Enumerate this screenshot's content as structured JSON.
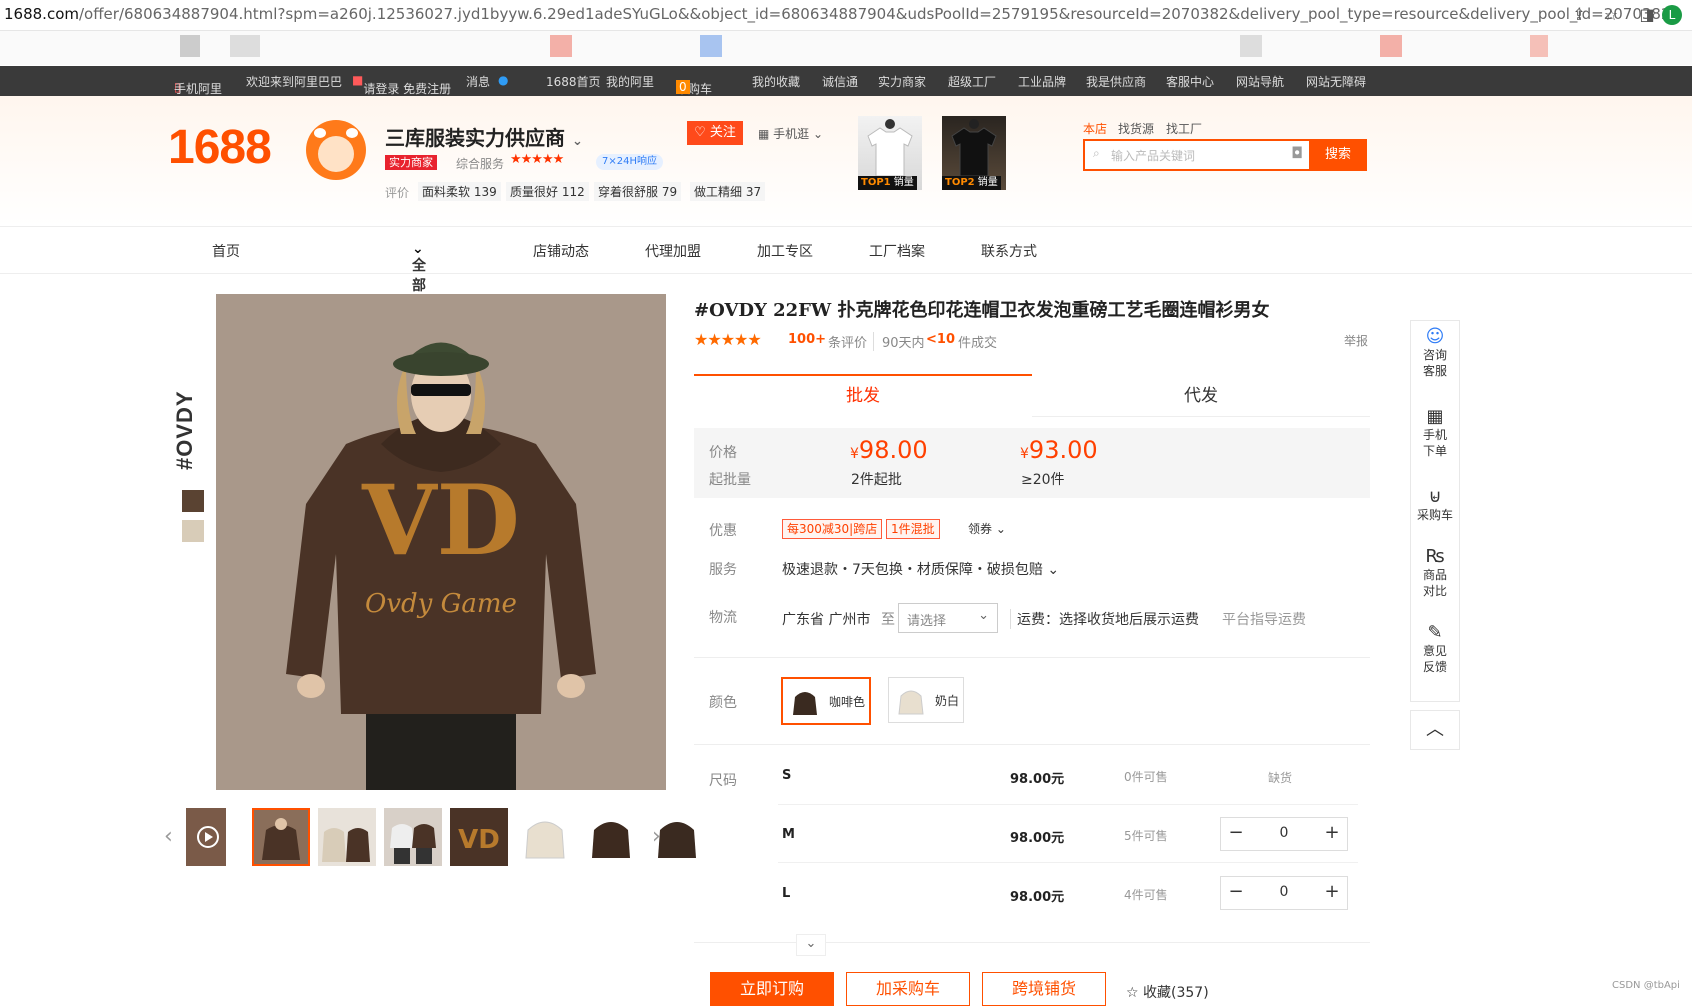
{
  "browser": {
    "url_domain": "1688.com",
    "url_rest": "/offer/680634887904.html?spm=a260j.12536027.jyd1byyw.6.29ed1adeSYuGLo&&object_id=680634887904&udsPoolId=2579195&resourceId=2070382&delivery_pool_type=resource&delivery_pool_id=2070382",
    "profile_initial": "L"
  },
  "topnav": {
    "mobile": "手机阿里",
    "welcome": "欢迎来到阿里巴巴",
    "login": "请登录 免费注册",
    "msg": "消息",
    "home": "1688首页",
    "my": "我的阿里",
    "cart": "采购车",
    "cart_count": "0",
    "fav": "我的收藏",
    "chengxin": "诚信通",
    "merchant": "实力商家",
    "factory": "超级工厂",
    "industry": "工业品牌",
    "supplier": "我是供应商",
    "service": "客服中心",
    "sitenav": "网站导航",
    "barrier": "网站无障碍"
  },
  "store": {
    "logo": "1688",
    "name": "三库服装实力供应商",
    "badge": "实力商家",
    "service_label": "综合服务",
    "service_stars": "★★★★★",
    "response": "7×24H响应",
    "eval_label": "评价",
    "eval_tags": [
      "面料柔软 139",
      "质量很好 112",
      "穿着很舒服 79",
      "做工精细 37"
    ],
    "follow": "关注",
    "mobile_buy": "手机逛",
    "top1": "TOP1",
    "top2": "TOP2",
    "sales": "销量"
  },
  "search": {
    "tabs": [
      "本店",
      "找货源",
      "找工厂"
    ],
    "placeholder": "输入产品关键词",
    "button": "搜索"
  },
  "shopnav": [
    "首页",
    "全部商品",
    "店铺动态",
    "代理加盟",
    "加工专区",
    "工厂档案",
    "联系方式"
  ],
  "product": {
    "brand_vertical": "#OVDY",
    "title": "#OVDY 22FW 扑克牌花色印花连帽卫衣发泡重磅工艺毛圈连帽衫男女",
    "stars": "★★★★★",
    "reviews_count": "100+",
    "reviews_label": "条评价",
    "days_label": "90天内",
    "deals_count": "<10",
    "deals_label": "件成交",
    "report": "举报"
  },
  "tabs": {
    "wholesale": "批发",
    "dropship": "代发"
  },
  "pricing": {
    "price_label": "价格",
    "moq_label": "起批量",
    "currency": "¥",
    "tiers": [
      {
        "price": "98.00",
        "moq": "2件起批"
      },
      {
        "price": "93.00",
        "moq": "≥20件"
      }
    ]
  },
  "promo": {
    "label": "优惠",
    "coupons": [
      "每300减30|跨店",
      "1件混批"
    ],
    "get_coupon": "领券"
  },
  "service": {
    "label": "服务",
    "text": "极速退款・7天包换・材质保障・破损包赔"
  },
  "logistics": {
    "label": "物流",
    "from": "广东省 广州市",
    "to": "至",
    "select_placeholder": "请选择",
    "fee": "运费：选择收货地后展示运费",
    "guide": "平台指导运费"
  },
  "colors": {
    "label": "颜色",
    "options": [
      "咖啡色",
      "奶白"
    ]
  },
  "sizes": {
    "label": "尺码",
    "rows": [
      {
        "size": "S",
        "price": "98.00元",
        "stock": "0件可售",
        "status": "缺货"
      },
      {
        "size": "M",
        "price": "98.00元",
        "stock": "5件可售",
        "qty": "0"
      },
      {
        "size": "L",
        "price": "98.00元",
        "stock": "4件可售",
        "qty": "0"
      }
    ]
  },
  "actions": {
    "buy_now": "立即订购",
    "add_cart": "加采购车",
    "cross_border": "跨境铺货",
    "favorite": "收藏(357)"
  },
  "sidebar": {
    "items": [
      "咨询\n客服",
      "手机\n下单",
      "采购车",
      "商品\n对比",
      "意见\n反馈"
    ]
  },
  "watermark": "CSDN @tbApi",
  "colors_theme": {
    "accent": "#ff5000",
    "dark_nav": "#3a3a3a",
    "price": "#ff4000"
  }
}
